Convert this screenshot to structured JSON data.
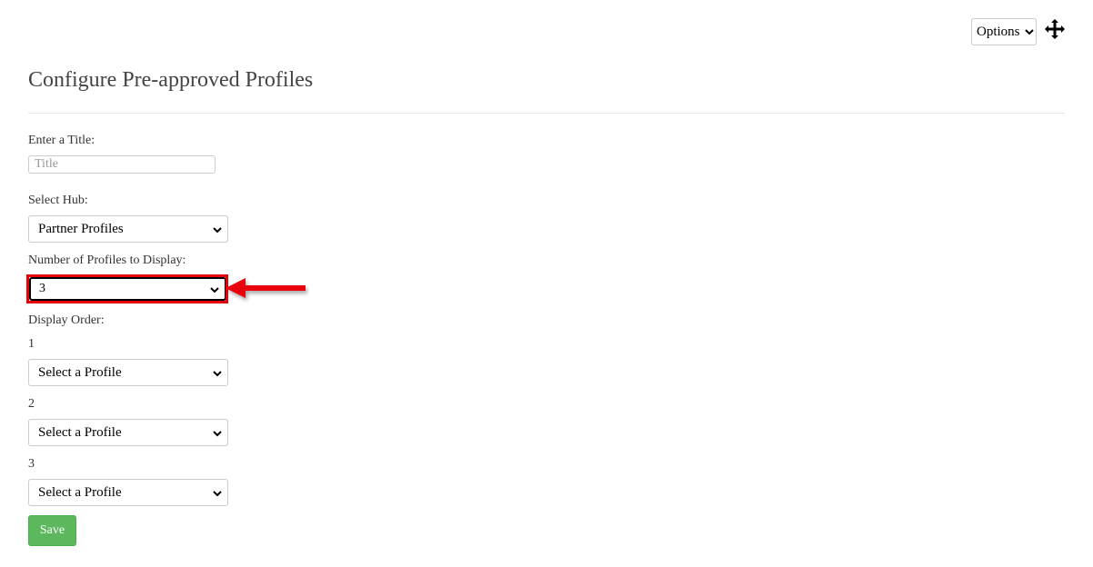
{
  "toolbar": {
    "options_label": "Options"
  },
  "page": {
    "title": "Configure Pre-approved Profiles"
  },
  "form": {
    "title_label": "Enter a Title:",
    "title_placeholder": "Title",
    "title_value": "",
    "hub_label": "Select Hub:",
    "hub_value": "Partner Profiles",
    "count_label": "Number of Profiles to Display:",
    "count_value": "3",
    "order_label": "Display Order:",
    "order_items": [
      {
        "index": "1",
        "value": "Select a Profile"
      },
      {
        "index": "2",
        "value": "Select a Profile"
      },
      {
        "index": "3",
        "value": "Select a Profile"
      }
    ],
    "save_label": "Save"
  },
  "annotation": {
    "highlight_color": "#e8000b"
  },
  "colors": {
    "save_button": "#5cb85c",
    "title_text": "#444444",
    "divider": "#e6e6e6"
  }
}
